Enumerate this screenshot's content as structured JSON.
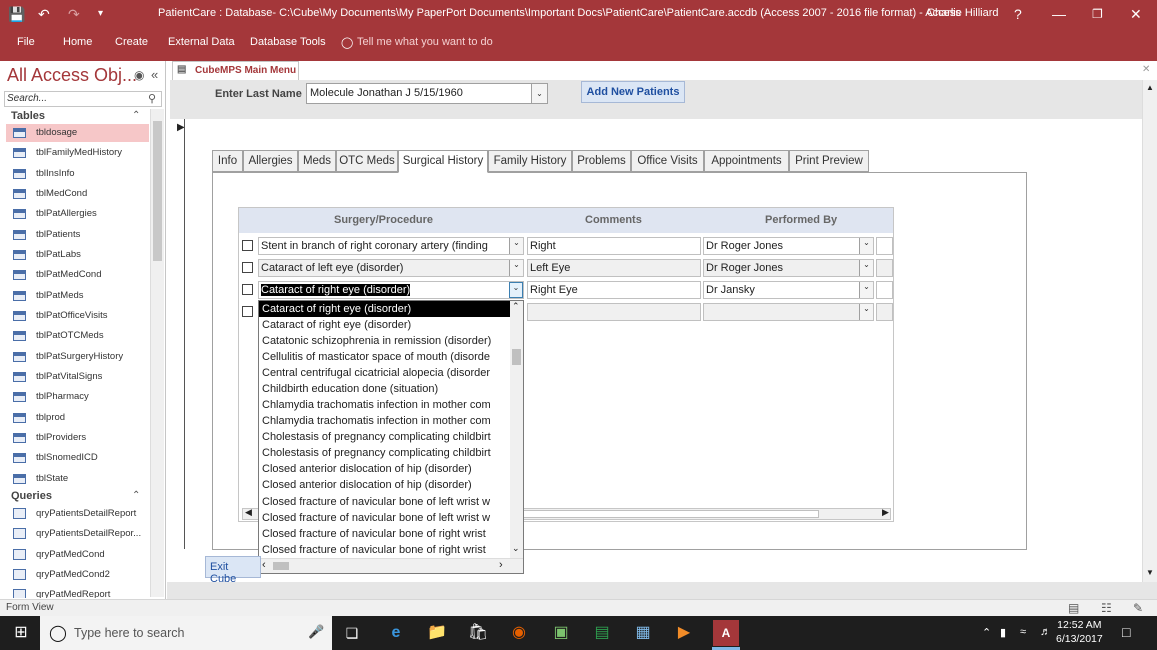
{
  "window": {
    "title": "PatientCare : Database- C:\\Cube\\My Documents\\My PaperPort Documents\\Important Docs\\PatientCare\\PatientCare.accdb (Access 2007 - 2016 file format)  -  Access",
    "user": "Charlie Hilliard",
    "help": "?"
  },
  "ribbon": {
    "items": [
      "File",
      "Home",
      "Create",
      "External Data",
      "Database Tools"
    ],
    "tell": "Tell me what you want to do"
  },
  "nav": {
    "title": "All Access Obj...",
    "search_placeholder": "Search...",
    "tables_header": "Tables",
    "queries_header": "Queries",
    "tables": [
      "tbldosage",
      "tblFamilyMedHistory",
      "tblInsInfo",
      "tblMedCond",
      "tblPatAllergies",
      "tblPatients",
      "tblPatLabs",
      "tblPatMedCond",
      "tblPatMeds",
      "tblPatOfficeVisits",
      "tblPatOTCMeds",
      "tblPatSurgeryHistory",
      "tblPatVitalSigns",
      "tblPharmacy",
      "tblprod",
      "tblProviders",
      "tblSnomedICD",
      "tblState"
    ],
    "queries": [
      "qryPatientsDetailReport",
      "qryPatientsDetailRepor...",
      "qryPatMedCond",
      "qryPatMedCond2",
      "qryPatMedReport"
    ]
  },
  "doc_tab": "CubeMPS Main Menu",
  "header": {
    "label": "Enter Last Name",
    "value": "Molecule  Jonathan  J  5/15/1960",
    "add_button": "Add New Patients"
  },
  "tabs": [
    "Info",
    "Allergies",
    "Meds",
    "OTC Meds",
    "Surgical History",
    "Family History",
    "Problems",
    "Office Visits",
    "Appointments",
    "Print Preview"
  ],
  "active_tab": "Surgical History",
  "grid": {
    "columns": [
      "Surgery/Procedure",
      "Comments",
      "Performed By"
    ],
    "rows": [
      {
        "procedure": "Stent in branch of right coronary artery (finding",
        "comment": "Right",
        "by": "Dr Roger Jones"
      },
      {
        "procedure": "Cataract of left eye (disorder)",
        "comment": "Left Eye",
        "by": "Dr Roger Jones"
      },
      {
        "procedure": "Cataract of right eye (disorder)",
        "comment": "Right Eye",
        "by": "Dr Jansky"
      },
      {
        "procedure": "",
        "comment": "",
        "by": ""
      }
    ]
  },
  "dropdown": {
    "items": [
      "Cataract of right eye (disorder)",
      "Cataract of right eye (disorder)",
      "Catatonic schizophrenia in remission (disorder)",
      "Cellulitis of masticator space of mouth (disorde",
      "Central centrifugal cicatricial alopecia (disorder",
      "Childbirth education done (situation)",
      "Chlamydia trachomatis infection in mother com",
      "Chlamydia trachomatis infection in mother com",
      "Cholestasis of pregnancy complicating childbirt",
      "Cholestasis of pregnancy complicating childbirt",
      "Closed anterior dislocation of hip (disorder)",
      "Closed anterior dislocation of hip (disorder)",
      "Closed fracture of navicular bone of left wrist w",
      "Closed fracture of navicular bone of left wrist w",
      "Closed fracture of navicular bone of right wrist",
      "Closed fracture of navicular bone of right wrist"
    ]
  },
  "exit_button": "Exit Cube",
  "status": "Form View",
  "taskbar": {
    "search": "Type here to search",
    "time": "12:52 AM",
    "date": "6/13/2017"
  }
}
